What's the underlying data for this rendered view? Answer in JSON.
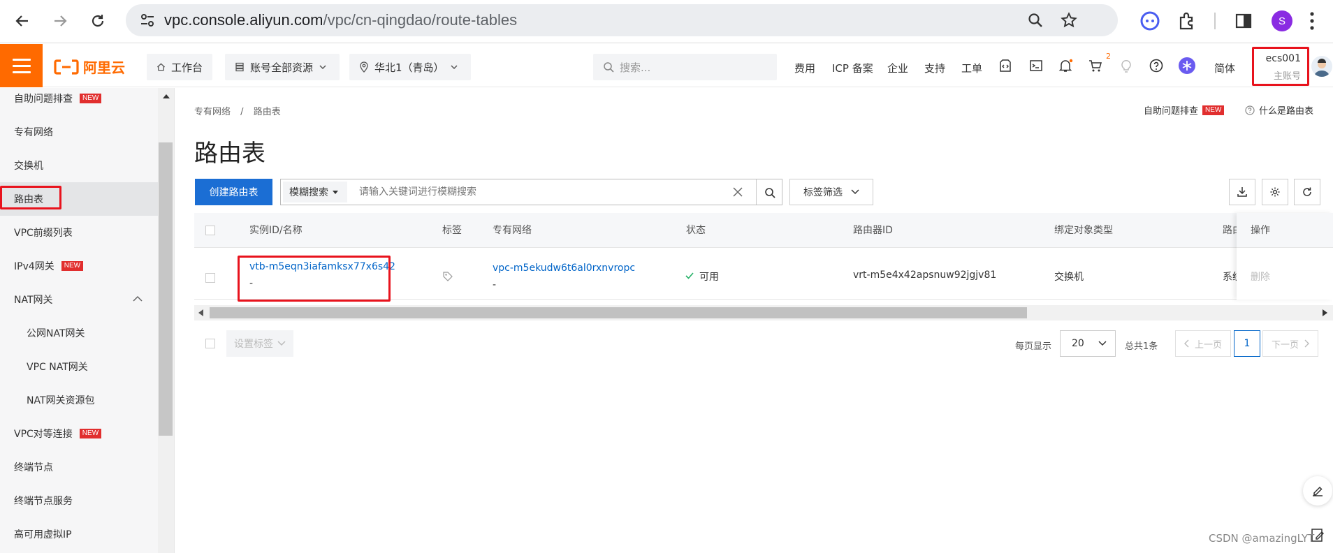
{
  "browser": {
    "url_host": "vpc.console.aliyun.com",
    "url_path": "/vpc/cn-qingdao/route-tables",
    "profile_initial": "S"
  },
  "header": {
    "logo_text": "阿里云",
    "workbench": "工作台",
    "resource_group": "账号全部资源",
    "region": "华北1（青岛）",
    "search_placeholder": "搜索...",
    "links": [
      "费用",
      "ICP 备案",
      "企业",
      "支持",
      "工单"
    ],
    "cart_badge": "2",
    "language": "简体",
    "account_name": "ecs001",
    "account_type": "主账号"
  },
  "sidebar": {
    "items": [
      {
        "label": "自助问题排查",
        "badge": "NEW"
      },
      {
        "label": "专有网络"
      },
      {
        "label": "交换机"
      },
      {
        "label": "路由表"
      },
      {
        "label": "VPC前缀列表"
      },
      {
        "label": "IPv4网关",
        "badge": "NEW"
      },
      {
        "label": "NAT网关"
      },
      {
        "label": "公网NAT网关"
      },
      {
        "label": "VPC NAT网关"
      },
      {
        "label": "NAT网关资源包"
      },
      {
        "label": "VPC对等连接",
        "badge": "NEW"
      },
      {
        "label": "终端节点"
      },
      {
        "label": "终端节点服务"
      },
      {
        "label": "高可用虚拟IP"
      }
    ]
  },
  "page": {
    "breadcrumb_root": "专有网络",
    "breadcrumb_sep": "/",
    "breadcrumb_current": "路由表",
    "title": "路由表",
    "self_check": "自助问题排查",
    "self_check_badge": "NEW",
    "what_is": "什么是路由表"
  },
  "toolbar": {
    "create_label": "创建路由表",
    "search_mode": "模糊搜索",
    "search_placeholder": "请输入关键词进行模糊搜索",
    "tag_filter": "标签筛选"
  },
  "table": {
    "columns": [
      "实例ID/名称",
      "标签",
      "专有网络",
      "状态",
      "路由器ID",
      "绑定对象类型",
      "路由",
      "操作"
    ],
    "rows": [
      {
        "id": "vtb-m5eqn3iafamksx77x6s42",
        "name": "-",
        "vpc_id": "vpc-m5ekudw6t6al0rxnvropc",
        "vpc_name": "-",
        "status": "可用",
        "router_id": "vrt-m5e4x42apsnuw92jgjv81",
        "bind_type": "交换机",
        "route_type": "系统",
        "action": "删除"
      }
    ]
  },
  "footer": {
    "set_tags": "设置标签",
    "per_page_label": "每页显示",
    "per_page_value": "20",
    "total": "总共1条",
    "prev": "上一页",
    "current_page": "1",
    "next": "下一页"
  },
  "watermark": "CSDN @amazingLYT",
  "colors": {
    "brand_orange": "#ff6a00",
    "primary_blue": "#1b6ed4",
    "link_blue": "#0064c8",
    "highlight_red": "#e8131d",
    "success_green": "#23b066"
  }
}
